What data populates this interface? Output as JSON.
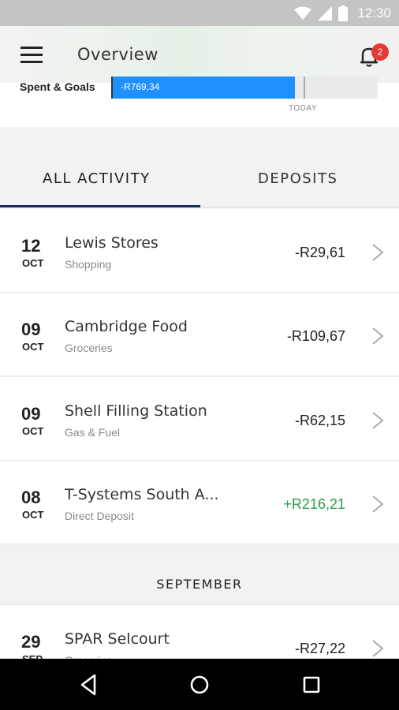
{
  "status_bar": {
    "time": "12:30",
    "icons": [
      "wifi-icon",
      "signal-icon",
      "battery-icon"
    ]
  },
  "app_bar": {
    "title": "Overview",
    "notification_count": "2"
  },
  "goals": {
    "label": "Spent & Goals",
    "spent_amount": "-R769,34",
    "today_label": "TODAY",
    "spent_fill_fraction": 0.69,
    "fill_color": "#1e90ff"
  },
  "tabs": [
    {
      "label": "ALL ACTIVITY",
      "selected": true
    },
    {
      "label": "DEPOSITS",
      "selected": false
    }
  ],
  "transactions": [
    {
      "day": "12",
      "month": "OCT",
      "merchant": "Lewis Stores",
      "category": "Shopping",
      "amount": "-R29,61",
      "positive": false
    },
    {
      "day": "09",
      "month": "OCT",
      "merchant": "Cambridge Food",
      "category": "Groceries",
      "amount": "-R109,67",
      "positive": false
    },
    {
      "day": "09",
      "month": "OCT",
      "merchant": "Shell Filling Station",
      "category": "Gas & Fuel",
      "amount": "-R62,15",
      "positive": false
    },
    {
      "day": "08",
      "month": "OCT",
      "merchant": "T-Systems South A...",
      "category": "Direct Deposit",
      "amount": "+R216,21",
      "positive": true
    }
  ],
  "section_header": "SEPTEMBER",
  "september_transactions": [
    {
      "day": "29",
      "month": "SEP",
      "merchant": "SPAR Selcourt",
      "category": "Groceries",
      "amount": "-R27,22",
      "positive": false
    }
  ],
  "colors": {
    "positive": "#2e9d47",
    "accent": "#1e90ff",
    "badge": "#e53935",
    "tab_indicator": "#1f2a5a"
  }
}
